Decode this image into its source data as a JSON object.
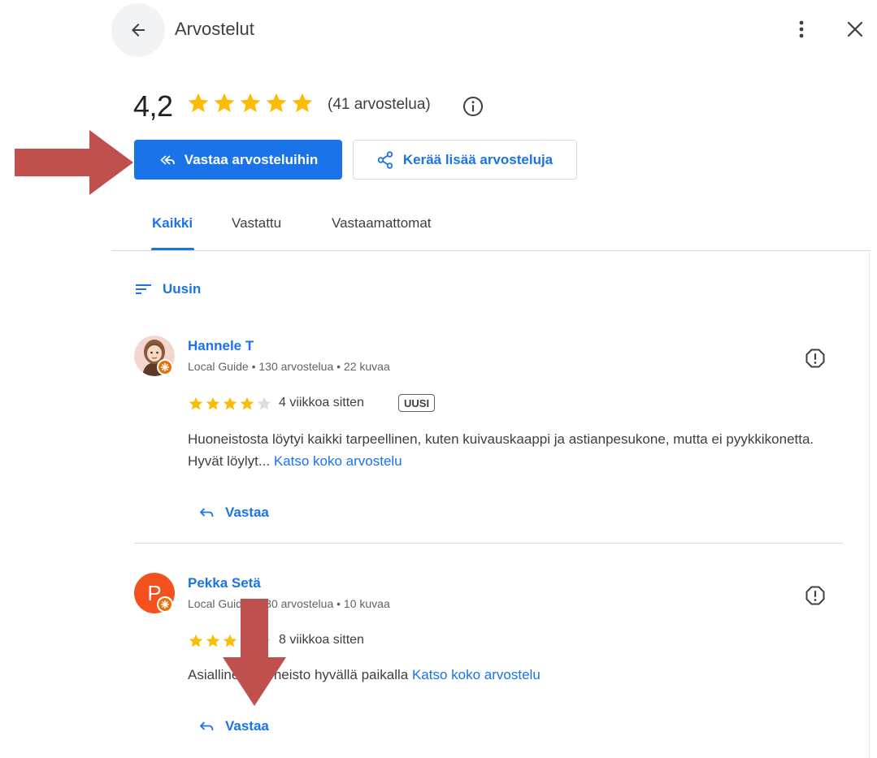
{
  "header": {
    "title": "Arvostelut",
    "back_icon": "arrow-back-icon",
    "more_icon": "more-vertical-icon",
    "close_icon": "close-icon"
  },
  "summary": {
    "rating": "4,2",
    "stars": 4.2,
    "review_count": "(41 arvostelua)",
    "star_color": "#fbbc04"
  },
  "actions": {
    "reply_reviews": "Vastaa arvosteluihin",
    "collect_reviews": "Kerää lisää arvosteluja"
  },
  "tabs": [
    {
      "label": "Kaikki",
      "active": true
    },
    {
      "label": "Vastattu",
      "active": false
    },
    {
      "label": "Vastaamattomat",
      "active": false
    }
  ],
  "sort": {
    "label": "Uusin"
  },
  "reviews": [
    {
      "name": "Hannele T",
      "meta": "Local Guide • 130 arvostelua • 22 kuvaa",
      "stars": 4,
      "time": "4 viikkoa sitten",
      "badge": "UUSI",
      "text": "Huoneistosta löytyi kaikki tarpeellinen, kuten kuivauskaappi ja astianpesukone, mutta ei pyykkikonetta. Hyvät löylyt...",
      "read_more": "Katso koko arvostelu",
      "reply": "Vastaa"
    },
    {
      "name": "Pekka Setä",
      "avatar_letter": "P",
      "meta": "Local Guide • 130 arvostelua • 10 kuvaa",
      "stars": 4,
      "time": "8 viikkoa sitten",
      "text": "Asiallinen huoneisto hyvällä paikalla",
      "read_more": "Katso koko arvostelu",
      "reply": "Vastaa"
    }
  ],
  "colors": {
    "accent": "#1a73e8",
    "annotation_arrow": "#c0504d"
  }
}
